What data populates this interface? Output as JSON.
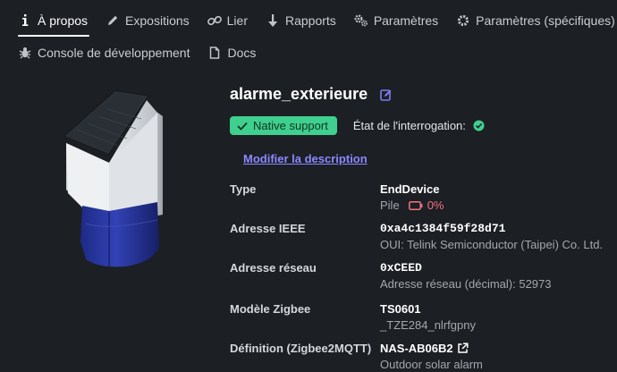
{
  "tabs": {
    "about": {
      "icon": "info-icon",
      "label": "À propos"
    },
    "exposes": {
      "icon": "pencil-icon",
      "label": "Expositions"
    },
    "bind": {
      "icon": "link-icon",
      "label": "Lier"
    },
    "reporting": {
      "icon": "download-arrow-icon",
      "label": "Rapports"
    },
    "settings": {
      "icon": "cogs-icon",
      "label": "Paramètres"
    },
    "settings_specific": {
      "icon": "gear-icon",
      "label": "Paramètres (spécifiques)"
    },
    "dev_console": {
      "icon": "bug-icon",
      "label": "Console de développement"
    },
    "docs": {
      "icon": "file-icon",
      "label": "Docs"
    }
  },
  "device": {
    "name": "alarme_exterieure",
    "support_badge": "Native support",
    "interrogation_label": "État de l'interrogation:",
    "edit_description": "Modifier la description",
    "image_icon": "outdoor-siren-image"
  },
  "info": {
    "type": {
      "label": "Type",
      "value": "EndDevice",
      "power_label": "Pile",
      "battery_pct": "0%"
    },
    "ieee": {
      "label": "Adresse IEEE",
      "value": "0xa4c1384f59f28d71",
      "sub": "OUI: Telink Semiconductor (Taipei) Co. Ltd."
    },
    "network": {
      "label": "Adresse réseau",
      "value": "0xCEED",
      "sub": "Adresse réseau (décimal): 52973"
    },
    "model": {
      "label": "Modèle Zigbee",
      "value": "TS0601",
      "sub": "_TZE284_nlrfgpny"
    },
    "definition": {
      "label": "Définition (Zigbee2MQTT)",
      "value": "NAS-AB06B2",
      "sub": "Outdoor solar alarm"
    }
  },
  "colors": {
    "background": "#1c1f24",
    "badge": "#3fcf8e",
    "accent": "#8c88ff",
    "battery": "#f47280"
  }
}
